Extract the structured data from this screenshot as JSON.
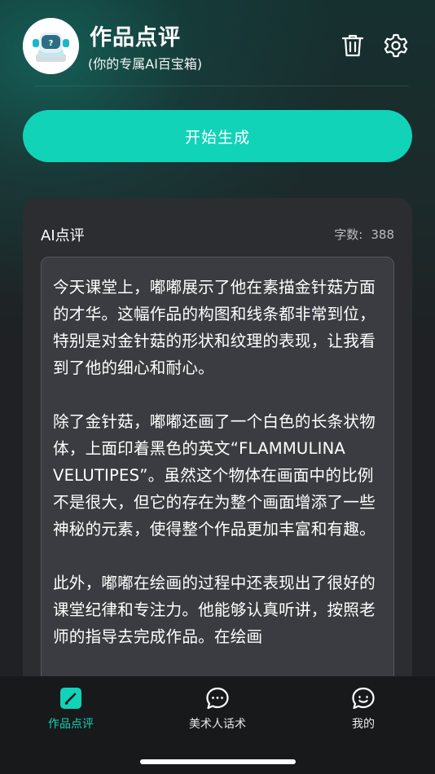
{
  "header": {
    "title": "作品点评",
    "subtitle": "(你的专属AI百宝箱)",
    "avatar_icon": "robot-icon",
    "actions": [
      {
        "icon": "trash-icon"
      },
      {
        "icon": "gear-icon"
      }
    ]
  },
  "main": {
    "start_button_label": "开始生成",
    "review_card": {
      "title": "AI点评",
      "count_label": "字数:",
      "count_value": "388",
      "paragraphs": [
        "今天课堂上，嘟嘟展示了他在素描金针菇方面的才华。这幅作品的构图和线条都非常到位，特别是对金针菇的形状和纹理的表现，让我看到了他的细心和耐心。",
        "除了金针菇，嘟嘟还画了一个白色的长条状物体，上面印着黑色的英文“FLAMMULINA VELUTIPES”。虽然这个物体在画面中的比例不是很大，但它的存在为整个画面增添了一些神秘的元素，使得整个作品更加丰富和有趣。",
        "此外，嘟嘟在绘画的过程中还表现出了很好的课堂纪律和专注力。他能够认真听讲，按照老师的指导去完成作品。在绘画"
      ]
    }
  },
  "tabbar": {
    "tabs": [
      {
        "label": "作品点评",
        "icon": "edit-square-icon",
        "active": true
      },
      {
        "label": "美术人话术",
        "icon": "chat-bubble-icon",
        "active": false
      },
      {
        "label": "我的",
        "icon": "smile-chat-icon",
        "active": false
      }
    ]
  },
  "colors": {
    "accent": "#10d3b7",
    "card": "#2b2d31",
    "textbox": "#3a3c41"
  }
}
